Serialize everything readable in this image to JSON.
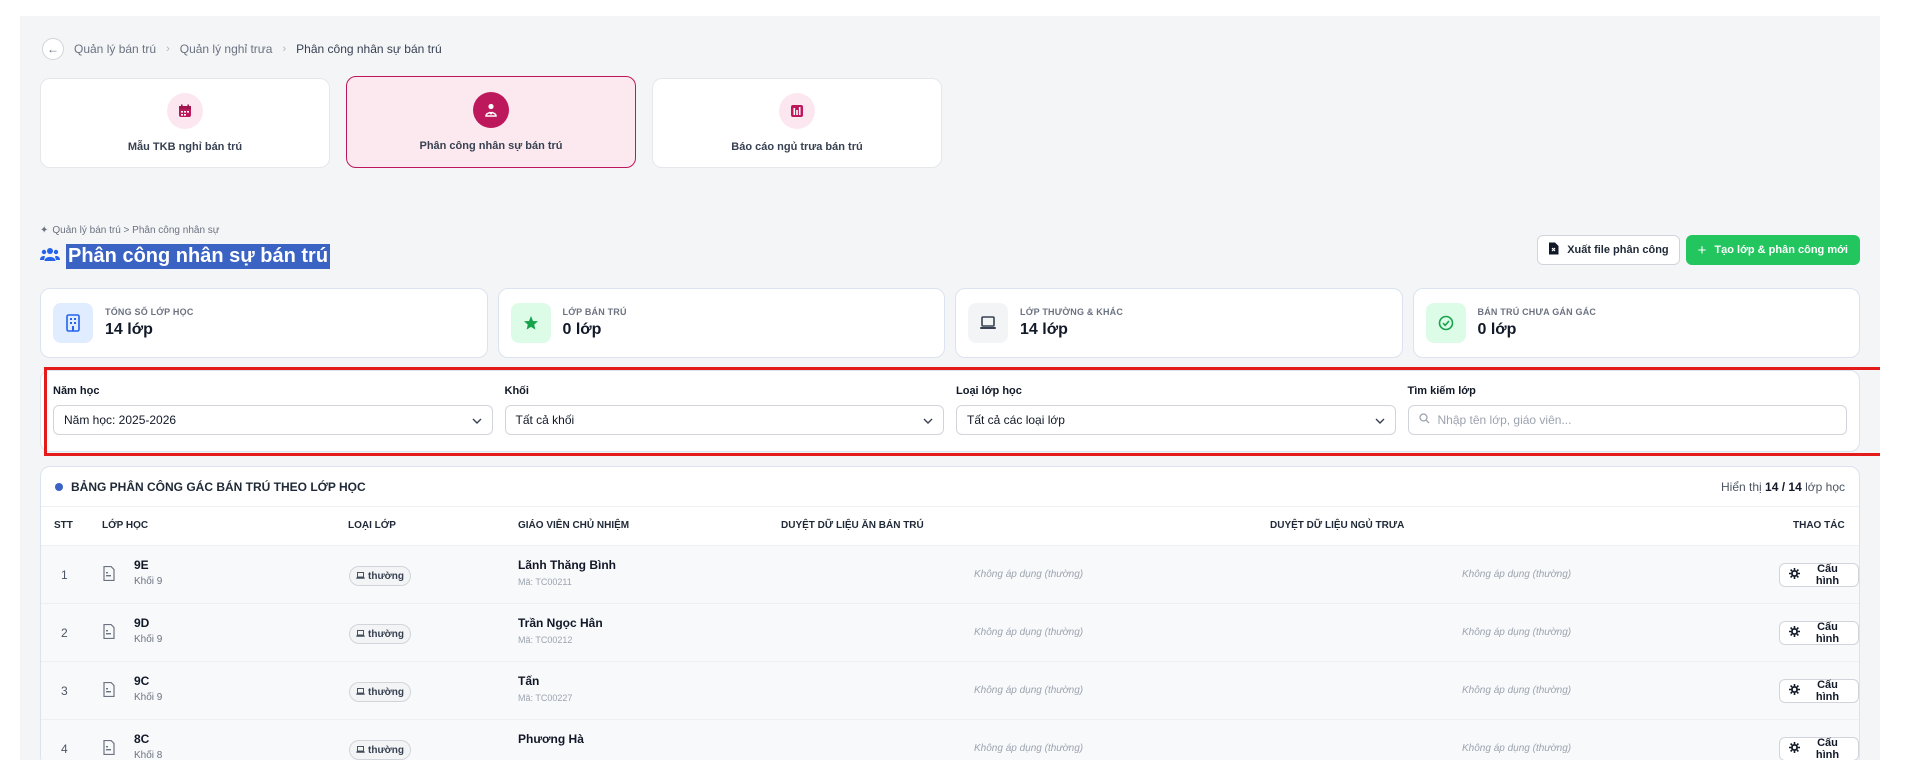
{
  "breadcrumb_top": {
    "items": [
      "Quản lý bán trú",
      "Quản lý nghỉ trưa",
      "Phân công nhân sự bán trú"
    ]
  },
  "module_cards": [
    {
      "label": "Mẫu TKB nghỉ bán trú",
      "icon": "calendar-icon"
    },
    {
      "label": "Phân công nhân sự bán trú",
      "icon": "person-assign-icon",
      "active": true
    },
    {
      "label": "Báo cáo ngủ trưa bán trú",
      "icon": "report-icon"
    }
  ],
  "section": {
    "sub_breadcrumb": "Quản lý bán trú > Phân công nhân sự",
    "title": "Phân công nhân sự bán trú"
  },
  "actions": {
    "export_label": "Xuất file phân công",
    "create_label": "Tạo lớp & phân công mới"
  },
  "stats": [
    {
      "label": "Tổng số lớp học",
      "value": "14 lớp",
      "icon": "building-icon",
      "color": "#e0ecff"
    },
    {
      "label": "Lớp bán trú",
      "value": "0 lớp",
      "icon": "star-icon",
      "color": "#dcfce7"
    },
    {
      "label": "Lớp thường & khác",
      "value": "14 lớp",
      "icon": "laptop-icon",
      "color": "#f3f4f6"
    },
    {
      "label": "Bán trú chưa gán gác",
      "value": "0 lớp",
      "icon": "check-circle-icon",
      "color": "#dcfce7"
    }
  ],
  "filters": {
    "year_label": "Năm học",
    "year_value": "Năm học: 2025-2026",
    "grade_label": "Khối",
    "grade_value": "Tất cả khối",
    "type_label": "Loại lớp học",
    "type_value": "Tất cả các loại lớp",
    "search_label": "Tìm kiếm lớp",
    "search_placeholder": "Nhập tên lớp, giáo viên..."
  },
  "table": {
    "title": "BẢNG PHÂN CÔNG GÁC BÁN TRÚ THEO LỚP HỌC",
    "count_prefix": "Hiển thị",
    "count_shown": "14",
    "count_sep": "/",
    "count_total": "14",
    "count_suffix": "lớp học",
    "headers": {
      "stt": "STT",
      "class": "LỚP HỌC",
      "type": "LOẠI LỚP",
      "teacher": "GIÁO VIÊN CHỦ NHIỆM",
      "meal": "DUYỆT DỮ LIỆU ĂN BÁN TRÚ",
      "nap": "DUYỆT DỮ LIỆU NGỦ TRƯA",
      "action": "THAO TÁC"
    },
    "rows": [
      {
        "stt": "1",
        "class": "9E",
        "grade": "Khối 9",
        "type": "thường",
        "teacher": "Lãnh Thăng Bình",
        "code": "Mã: TC00211",
        "meal": "Không áp dụng (thường)",
        "nap": "Không áp dụng (thường)",
        "action": "Cấu hình"
      },
      {
        "stt": "2",
        "class": "9D",
        "grade": "Khối 9",
        "type": "thường",
        "teacher": "Trần Ngọc Hân",
        "code": "Mã: TC00212",
        "meal": "Không áp dụng (thường)",
        "nap": "Không áp dụng (thường)",
        "action": "Cấu hình"
      },
      {
        "stt": "3",
        "class": "9C",
        "grade": "Khối 9",
        "type": "thường",
        "teacher": "Tấn",
        "code": "Mã: TC00227",
        "meal": "Không áp dụng (thường)",
        "nap": "Không áp dụng (thường)",
        "action": "Cấu hình"
      },
      {
        "stt": "4",
        "class": "8C",
        "grade": "Khối 8",
        "type": "thường",
        "teacher": "Phương Hà",
        "code": "",
        "meal": "Không áp dụng (thường)",
        "nap": "Không áp dụng (thường)",
        "action": "Cấu hình"
      }
    ]
  }
}
